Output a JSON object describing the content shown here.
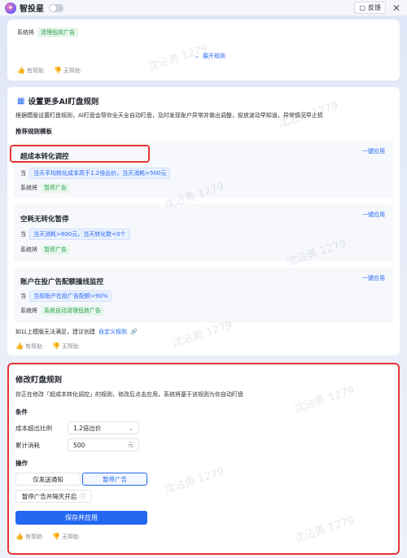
{
  "app": {
    "name": "智投星",
    "feedback": "反馈"
  },
  "card1": {
    "system_label": "系统将",
    "action_tag": "清理低效广告",
    "expand_link": "展开规则",
    "helpful": "有帮助",
    "not_helpful": "无帮助"
  },
  "card2": {
    "title": "设置更多AI盯盘规则",
    "description": "根据模版设置盯盘规则，AI盯盘会帮你全天全自动盯盘，及时发现账户异常并做出调整，投放波动早知道，异常情况早止损",
    "templates_heading": "推荐规则模板",
    "apply_label": "一键应用",
    "when_label": "当",
    "system_label": "系统将",
    "templates": [
      {
        "title": "超成本转化调控",
        "condition": "当天平均转化成本高于1.2倍出价，当天消耗>500元",
        "action": "暂停广告"
      },
      {
        "title": "空耗无转化暂停",
        "condition": "当天消耗>800元，当天转化数<0个",
        "action": "暂停广告"
      },
      {
        "title": "账户在投广告配额撞线监控",
        "condition": "当前账户在投广告配额>90%",
        "action": "系统自动清理低效广告"
      }
    ],
    "custom_hint": "如以上模版无法满足，建议创建",
    "custom_link": "自定义规则",
    "helpful": "有帮助",
    "not_helpful": "无帮助"
  },
  "card3": {
    "title": "修改盯盘规则",
    "description": "你正在修改「超成本转化调控」的规则，修改后点击应用，系统将基于该规则为你自动盯盘",
    "conditions_heading": "条件",
    "cost_ratio_label": "成本超出比例",
    "cost_ratio_value": "1.2倍出价",
    "spend_label": "累计消耗",
    "spend_value": "500",
    "spend_unit": "元",
    "actions_heading": "操作",
    "action_notify": "仅发送通知",
    "action_pause": "暂停广告",
    "action_pause_resume": "暂停广告并隔天开启",
    "save_button": "保存并应用",
    "helpful": "有帮助",
    "not_helpful": "无帮助"
  },
  "watermark": "沈沾勇 1279"
}
